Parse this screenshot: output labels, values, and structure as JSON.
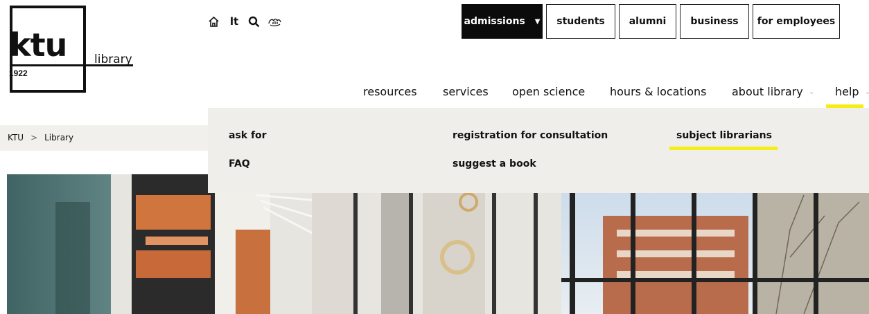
{
  "logo": {
    "wordmark": "ktu",
    "year": "1922",
    "section": "library"
  },
  "utility": {
    "home_icon": "home-icon",
    "language": "lt",
    "search_icon": "search-icon",
    "accessibility_icon": "sign-language-icon"
  },
  "audience_nav": [
    {
      "label": "admissions",
      "has_dropdown": true,
      "active": true
    },
    {
      "label": "students"
    },
    {
      "label": "alumni"
    },
    {
      "label": "business"
    },
    {
      "label": "for employees"
    }
  ],
  "main_nav": [
    {
      "label": "resources"
    },
    {
      "label": "services"
    },
    {
      "label": "open science"
    },
    {
      "label": "hours & locations"
    },
    {
      "label": "about library",
      "has_dropdown": true
    },
    {
      "label": "help",
      "has_dropdown": true,
      "active": true
    }
  ],
  "breadcrumb": {
    "items": [
      "KTU",
      "Library"
    ],
    "separator": ">"
  },
  "help_menu": {
    "col1": [
      "ask for",
      "FAQ"
    ],
    "col2": [
      "registration for consultation",
      "suggest a book"
    ],
    "col3": [
      "subject librarians"
    ],
    "highlighted": "subject librarians"
  },
  "colors": {
    "accent_yellow": "#f4ee14",
    "dark_button": "#0b0b0b",
    "panel_bg": "#efeeea"
  },
  "hero": {
    "description": "library interior photo"
  }
}
